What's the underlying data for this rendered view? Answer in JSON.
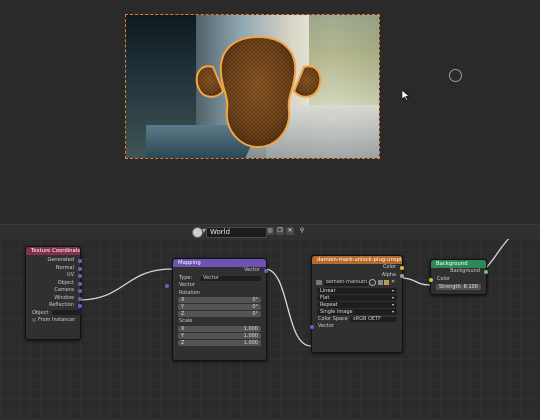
{
  "header": {
    "world_name": "World"
  },
  "nodes": {
    "texcoord": {
      "title": "Texture Coordinate",
      "outputs": [
        "Generated",
        "Normal",
        "UV",
        "Object",
        "Camera",
        "Window",
        "Reflection"
      ],
      "object_label": "Object",
      "from_instancer": "From Instancer"
    },
    "mapping": {
      "title": "Mapping",
      "output": "Vector",
      "type_label": "Type:",
      "type_value": "Vector",
      "vector_label": "Vector",
      "rotation_label": "Rotation",
      "rotation": [
        {
          "axis": "X",
          "value": "0°"
        },
        {
          "axis": "Y",
          "value": "0°"
        },
        {
          "axis": "Z",
          "value": "0°"
        }
      ],
      "scale_label": "Scale",
      "scale": [
        {
          "axis": "X",
          "value": "1.000"
        },
        {
          "axis": "Y",
          "value": "1.000"
        },
        {
          "axis": "Z",
          "value": "1.000"
        }
      ]
    },
    "envtex": {
      "title": "damien-mark-unlock-plug-unsplash.jpg",
      "out_color": "Color",
      "out_alpha": "Alpha",
      "image_name": "damien-markuth...",
      "options": [
        "Linear",
        "Flat",
        "Repeat",
        "Single Image"
      ],
      "colorspace_label": "Color Space",
      "colorspace_value": "sRGB OETF",
      "input_vector": "Vector"
    },
    "background": {
      "title": "Background",
      "output": "Background",
      "input_color": "Color",
      "strength_label": "Strength",
      "strength_value": "8.100"
    }
  }
}
